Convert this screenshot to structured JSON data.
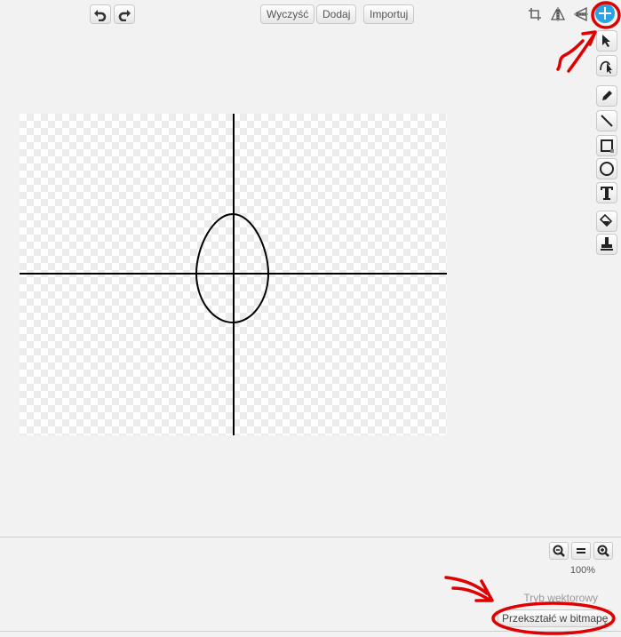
{
  "toolbar": {
    "undo_icon": "undo-icon",
    "redo_icon": "redo-icon",
    "clear_label": "Wyczyść",
    "add_label": "Dodaj",
    "import_label": "Importuj"
  },
  "top_icons": [
    "crop-icon",
    "flip-horizontal-icon",
    "flip-vertical-icon",
    "set-costume-center-icon"
  ],
  "tools": [
    "select-tool-icon",
    "reshape-tool-icon",
    "pencil-tool-icon",
    "line-tool-icon",
    "rectangle-tool-icon",
    "ellipse-tool-icon",
    "text-tool-icon",
    "fill-tool-icon",
    "stamp-tool-icon"
  ],
  "zoom": {
    "out_icon": "zoom-out-icon",
    "reset_icon": "zoom-reset-icon",
    "in_icon": "zoom-in-icon",
    "level": "100%"
  },
  "mode": {
    "label": "Tryb wektorowy",
    "convert_button": "Przekształć w bitmapę"
  },
  "colors": {
    "accent": "#2aa3e0",
    "annotation": "#e00000"
  }
}
